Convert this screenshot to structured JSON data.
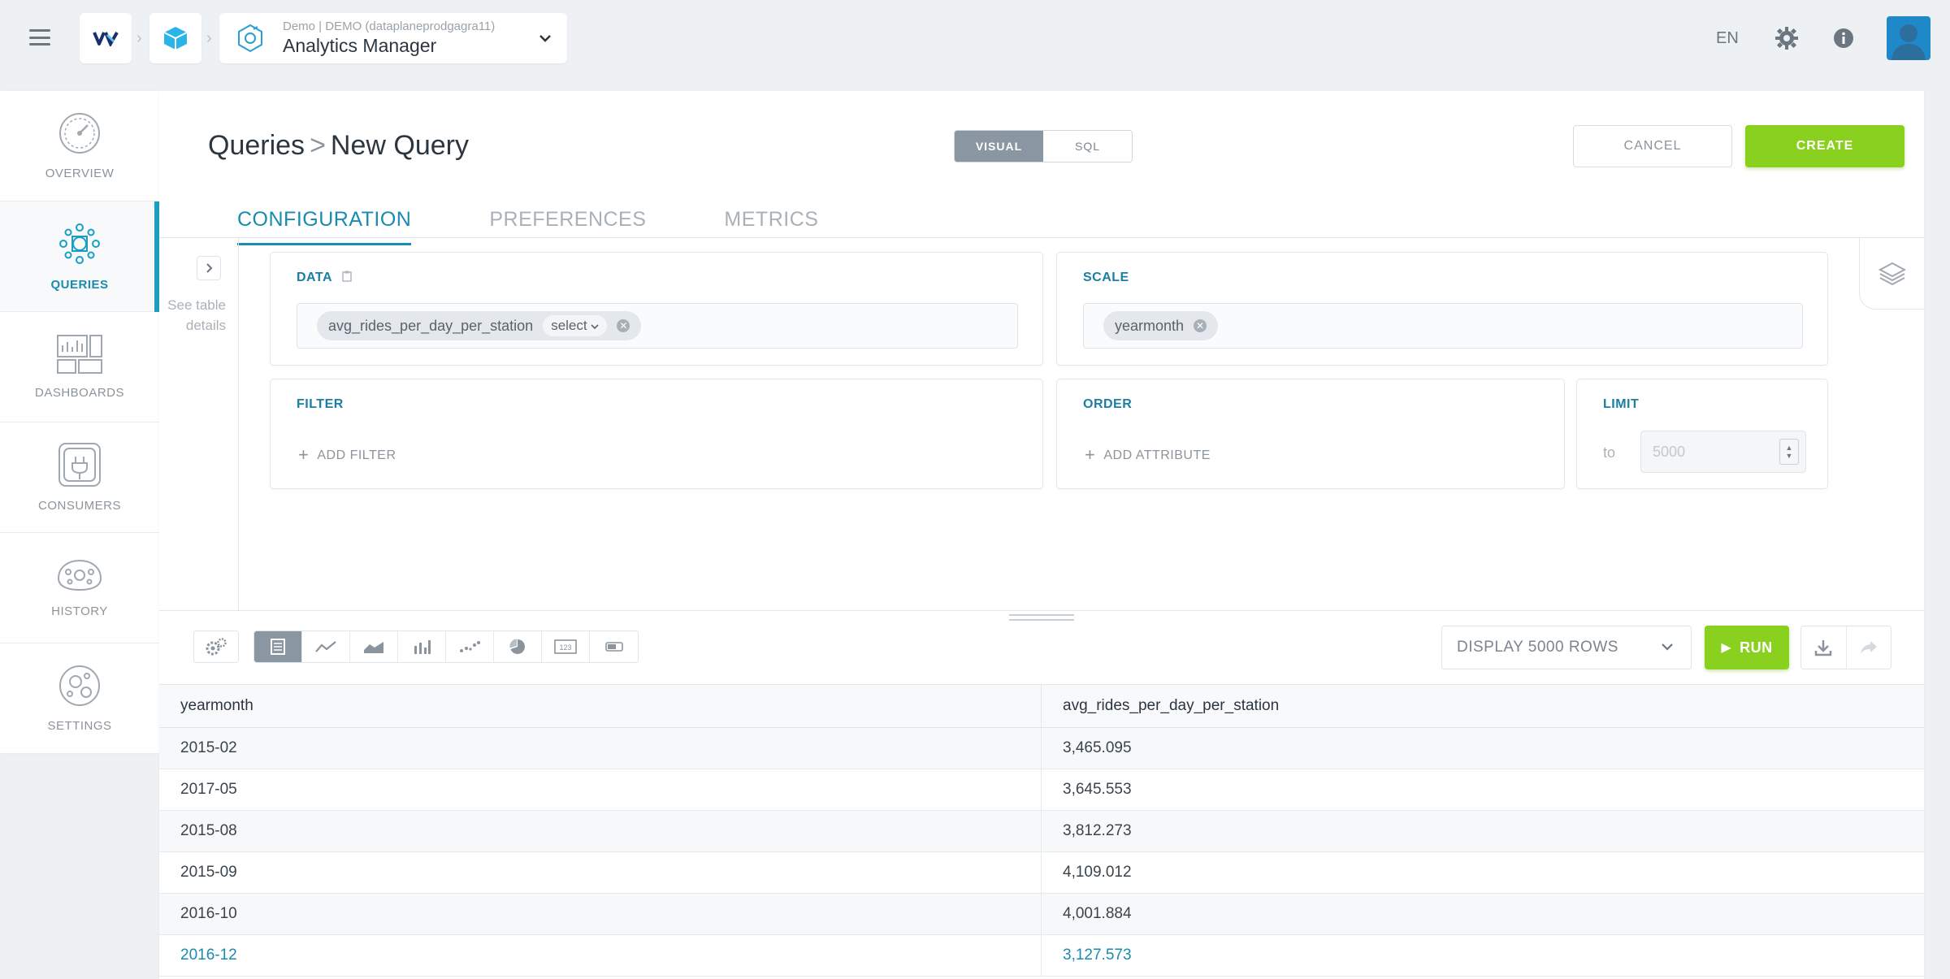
{
  "header": {
    "app_sub": "Demo | DEMO (dataplaneprodgagra11)",
    "app_title": "Analytics Manager",
    "language": "EN",
    "icons": [
      "menu-icon",
      "vz-logo-icon",
      "cube-icon",
      "analytics-icon",
      "chevron-down-icon",
      "gear-icon",
      "info-icon",
      "user-avatar"
    ]
  },
  "nav": {
    "items": [
      {
        "label": "OVERVIEW",
        "icon": "gauge-icon"
      },
      {
        "label": "QUERIES",
        "icon": "queries-icon",
        "active": true
      },
      {
        "label": "DASHBOARDS",
        "icon": "dashboards-icon"
      },
      {
        "label": "CONSUMERS",
        "icon": "consumers-icon"
      },
      {
        "label": "HISTORY",
        "icon": "history-icon"
      },
      {
        "label": "SETTINGS",
        "icon": "settings-icon"
      }
    ]
  },
  "page": {
    "breadcrumb_root": "Queries",
    "breadcrumb_sep": ">",
    "breadcrumb_current": "New Query",
    "mode_visual": "VISUAL",
    "mode_sql": "SQL",
    "cancel_label": "CANCEL",
    "create_label": "CREATE",
    "tabs": [
      "CONFIGURATION",
      "PREFERENCES",
      "METRICS"
    ],
    "active_tab": "CONFIGURATION",
    "see_table_details": "See table details"
  },
  "config": {
    "data_title": "DATA",
    "data_chip": "avg_rides_per_day_per_station",
    "data_chip_agg": "select",
    "scale_title": "SCALE",
    "scale_chip": "yearmonth",
    "filter_title": "FILTER",
    "add_filter": "ADD FILTER",
    "order_title": "ORDER",
    "add_attribute": "ADD ATTRIBUTE",
    "limit_title": "LIMIT",
    "limit_to": "to",
    "limit_placeholder": "5000"
  },
  "toolbar": {
    "viz_types": [
      "table-icon",
      "line-chart-icon",
      "area-chart-icon",
      "bar-chart-icon",
      "scatter-icon",
      "pie-chart-icon",
      "number-icon",
      "gauge-icon"
    ],
    "active_viz": "table-icon",
    "display_rows": "DISPLAY 5000 ROWS",
    "run_label": "RUN"
  },
  "results": {
    "columns": [
      "yearmonth",
      "avg_rides_per_day_per_station"
    ],
    "rows": [
      [
        "2015-02",
        "3,465.095"
      ],
      [
        "2017-05",
        "3,645.553"
      ],
      [
        "2015-08",
        "3,812.273"
      ],
      [
        "2015-09",
        "4,109.012"
      ],
      [
        "2016-10",
        "4,001.884"
      ],
      [
        "2016-12",
        "3,127.573"
      ]
    ]
  },
  "colors": {
    "accent": "#1a8bb0",
    "create_green": "#8ad11f",
    "avatar_blue": "#1e88c9"
  }
}
